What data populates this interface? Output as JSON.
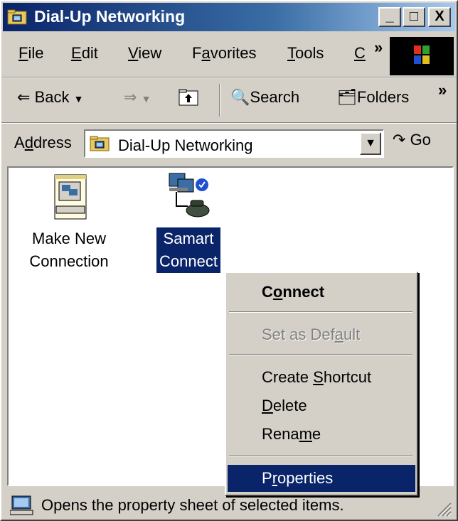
{
  "window": {
    "title": "Dial-Up Networking",
    "controls": {
      "minimize": "_",
      "maximize": "□",
      "close": "X"
    }
  },
  "menubar": {
    "items": [
      {
        "label": "File",
        "underline": "F",
        "rest": "ile"
      },
      {
        "label": "Edit",
        "underline": "E",
        "rest": "dit"
      },
      {
        "label": "View",
        "underline": "V",
        "rest": "iew"
      },
      {
        "label": "Favorites",
        "pre": "F",
        "underline": "a",
        "rest": "vorites"
      },
      {
        "label": "Tools",
        "underline": "T",
        "rest": "ools"
      },
      {
        "label": "C",
        "underline": "C",
        "rest": ""
      }
    ],
    "more": "»"
  },
  "toolbar": {
    "back": "Back",
    "search": "Search",
    "folders": "Folders",
    "more": "»"
  },
  "addressbar": {
    "label_pre": "A",
    "label_underline": "d",
    "label_rest": "dress",
    "value": "Dial-Up Networking",
    "go": "Go"
  },
  "content": {
    "items": [
      {
        "line1": "Make New",
        "line2": "Connection",
        "icon": "make-new-connection-icon"
      },
      {
        "line1": "Samart",
        "line2": "Connect",
        "icon": "dialup-connection-icon",
        "selected": true
      }
    ]
  },
  "context_menu": {
    "connect_pre": "C",
    "connect_u": "o",
    "connect_rest": "nnect",
    "default_pre": "Set as Def",
    "default_u": "a",
    "default_rest": "ult",
    "shortcut_pre": "Create ",
    "shortcut_u": "S",
    "shortcut_rest": "hortcut",
    "delete_u": "D",
    "delete_rest": "elete",
    "rename_pre": "Rena",
    "rename_u": "m",
    "rename_rest": "e",
    "properties_pre": "P",
    "properties_u": "r",
    "properties_rest": "operties"
  },
  "statusbar": {
    "text": "Opens the property sheet of selected items."
  },
  "colors": {
    "face": "#d4d0c8",
    "highlight": "#0a246a",
    "title_gradient_end": "#a6caf0"
  }
}
